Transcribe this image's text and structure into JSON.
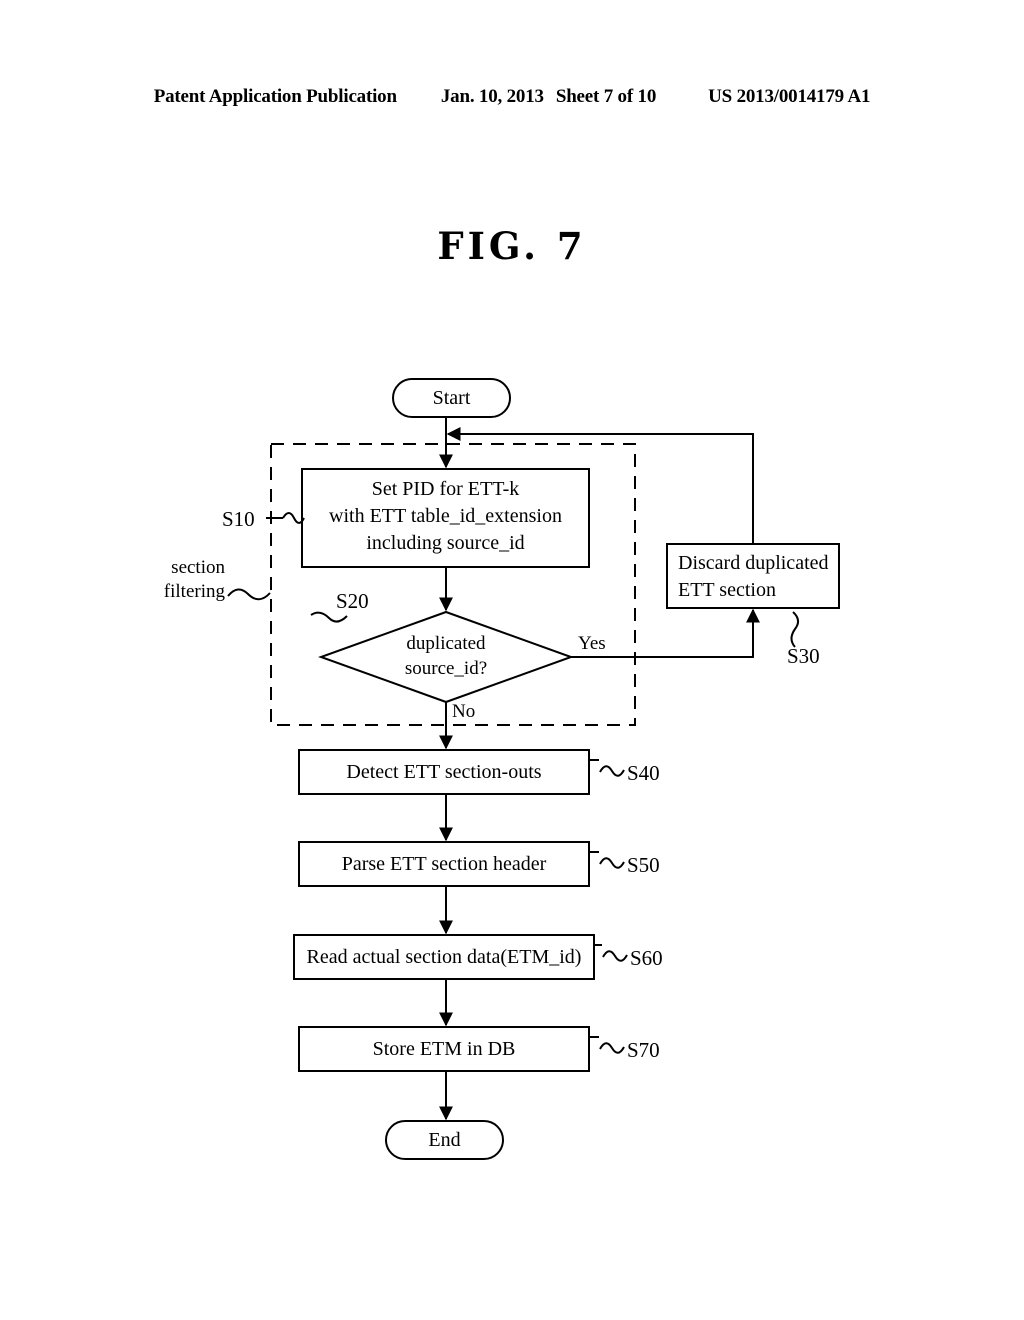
{
  "header": {
    "publication": "Patent Application Publication",
    "date": "Jan. 10, 2013",
    "sheet": "Sheet 7 of 10",
    "patent_number": "US 2013/0014179 A1"
  },
  "figure": {
    "title": "FIG. 7"
  },
  "flowchart": {
    "start_label": "Start",
    "end_label": "End",
    "group_label_line1": "section",
    "group_label_line2": "filtering",
    "steps": [
      {
        "id": "S10",
        "shape": "process",
        "lines": [
          "Set PID for ETT-k",
          "with ETT table_id_extension",
          "including source_id"
        ]
      },
      {
        "id": "S20",
        "shape": "decision",
        "lines": [
          "duplicated",
          "source_id?"
        ],
        "yes_label": "Yes",
        "no_label": "No"
      },
      {
        "id": "S30",
        "shape": "process",
        "lines": [
          "Discard duplicated",
          "ETT section"
        ]
      },
      {
        "id": "S40",
        "shape": "process",
        "lines": [
          "Detect ETT section-outs"
        ]
      },
      {
        "id": "S50",
        "shape": "process",
        "lines": [
          "Parse ETT section header"
        ]
      },
      {
        "id": "S60",
        "shape": "process",
        "lines": [
          "Read actual section data(ETM_id)"
        ]
      },
      {
        "id": "S70",
        "shape": "process",
        "lines": [
          "Store ETM in DB"
        ]
      }
    ],
    "colors": {
      "line": "#000000",
      "background": "#ffffff"
    }
  }
}
